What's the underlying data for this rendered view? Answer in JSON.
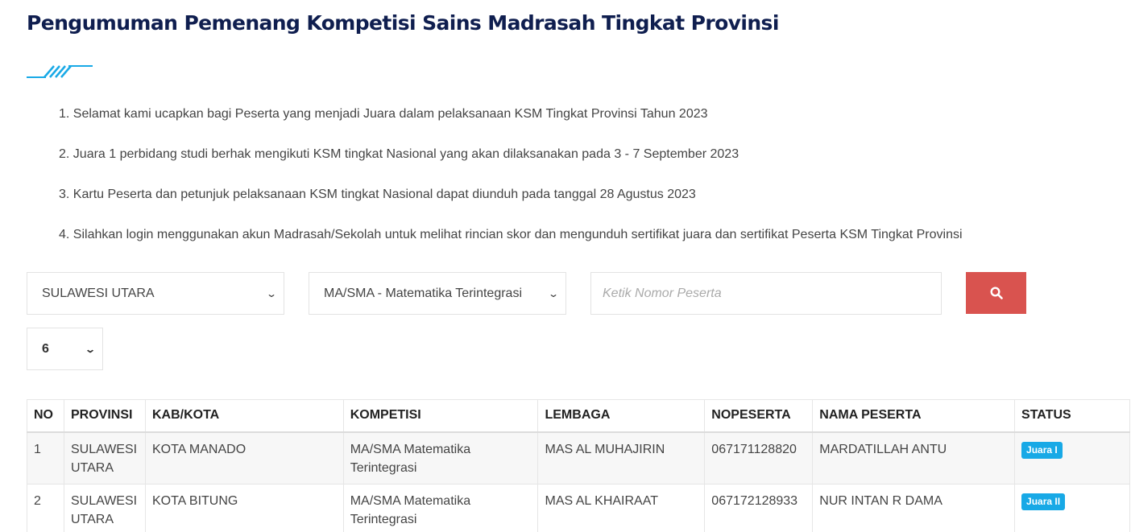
{
  "page": {
    "title": "Pengumuman Pemenang Kompetisi Sains Madrasah Tingkat Provinsi"
  },
  "notices": [
    "1. Selamat kami ucapkan bagi Peserta yang menjadi Juara dalam pelaksanaan KSM Tingkat Provinsi Tahun 2023",
    "2. Juara 1 perbidang studi berhak mengikuti KSM tingkat Nasional yang akan dilaksanakan pada 3 - 7 September 2023",
    "3. Kartu Peserta dan petunjuk pelaksanaan KSM tingkat Nasional dapat diunduh pada tanggal 28 Agustus 2023",
    "4. Silahkan login menggunakan akun Madrasah/Sekolah untuk melihat rincian skor dan mengunduh sertifikat juara dan sertifikat Peserta KSM Tingkat Provinsi"
  ],
  "filters": {
    "province": "SULAWESI UTARA",
    "competition": "MA/SMA - Matematika Terintegrasi",
    "search_placeholder": "Ketik Nomor Peserta",
    "page_size": "6"
  },
  "table": {
    "headers": [
      "NO",
      "PROVINSI",
      "KAB/KOTA",
      "KOMPETISI",
      "LEMBAGA",
      "NOPESERTA",
      "NAMA PESERTA",
      "STATUS"
    ],
    "rows": [
      {
        "no": "1",
        "provinsi": "SULAWESI UTARA",
        "kabkota": "KOTA MANADO",
        "kompetisi": "MA/SMA Matematika Terintegrasi",
        "lembaga": "MAS AL MUHAJIRIN",
        "nopeserta": "067171128820",
        "nama": "MARDATILLAH ANTU",
        "status": "Juara I"
      },
      {
        "no": "2",
        "provinsi": "SULAWESI UTARA",
        "kabkota": "KOTA BITUNG",
        "kompetisi": "MA/SMA Matematika Terintegrasi",
        "lembaga": "MAS AL KHAIRAAT",
        "nopeserta": "067172128933",
        "nama": "NUR INTAN R DAMA",
        "status": "Juara II"
      }
    ]
  },
  "icons": {
    "search": "search-icon",
    "chevron": "chevron-down-icon"
  },
  "colors": {
    "title": "#0f1e4f",
    "accent": "#18a9e6",
    "search_button": "#d9534f",
    "badge": "#18a9e6"
  }
}
